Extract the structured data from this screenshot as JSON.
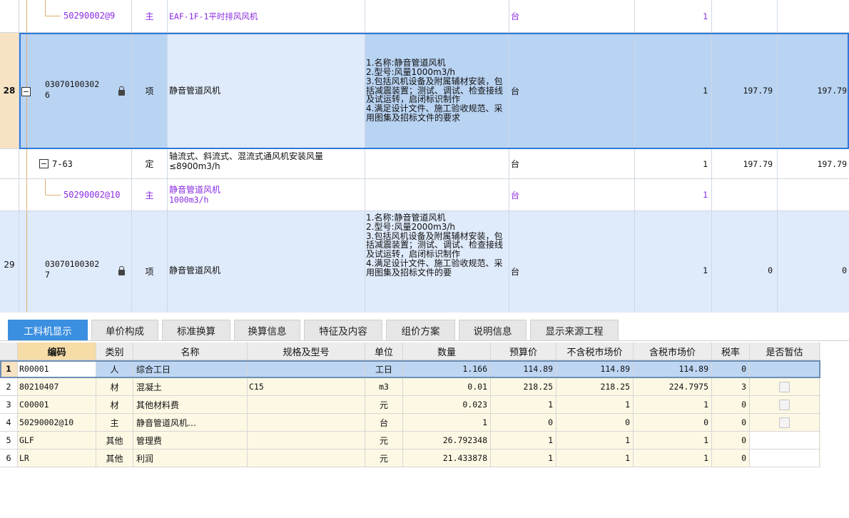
{
  "upper_rows": [
    {
      "row_num": "",
      "code": "50290002@9",
      "type": "主",
      "name": "EAF-1F-1平时排风风机",
      "features": "",
      "unit": "台",
      "qty": "1",
      "price1": "",
      "price2": ""
    },
    {
      "row_num": "28",
      "code_line1": "03070100302",
      "code_line2": "6",
      "type": "项",
      "name": "静音管道风机",
      "features": "1.名称:静音管道风机\n2.型号:风量1000m3/h\n3.包括风机设备及附属辅材安装，包括减震装置；测试、调试、检查接线及试运转，启闭标识制作\n4.满足设计文件、施工验收规范、采用图集及招标文件的要求",
      "unit": "台",
      "qty": "1",
      "price1": "197.79",
      "price2": "197.79"
    },
    {
      "row_num": "",
      "code": "7-63",
      "type": "定",
      "name": "轴流式、斜流式、混流式通风机安装风量≤8900m3/h",
      "features": "",
      "unit": "台",
      "qty": "1",
      "price1": "197.79",
      "price2": "197.79"
    },
    {
      "row_num": "",
      "code": "50290002@10",
      "type": "主",
      "name_line1": "静音管道风机",
      "name_line2": "1000m3/h",
      "features": "",
      "unit": "台",
      "qty": "1",
      "price1": "",
      "price2": ""
    },
    {
      "row_num": "29",
      "code_line1": "03070100302",
      "code_line2": "7",
      "type": "项",
      "name": "静音管道风机",
      "features": "1.名称:静音管道风机\n2.型号:风量2000m3/h\n3.包括风机设备及附属辅材安装，包括减震装置；测试、调试、检查接线及试运转，启闭标识制作\n4.满足设计文件、施工验收规范、采用图集及招标文件的要",
      "unit": "台",
      "qty": "1",
      "price1": "0",
      "price2": "0"
    }
  ],
  "tabs": [
    "工料机显示",
    "单价构成",
    "标准换算",
    "换算信息",
    "特征及内容",
    "组价方案",
    "说明信息",
    "显示来源工程"
  ],
  "lower_headers": [
    "",
    "编码",
    "类别",
    "名称",
    "规格及型号",
    "单位",
    "数量",
    "预算价",
    "不含税市场价",
    "含税市场价",
    "税率",
    "是否暂估"
  ],
  "lower_rows": [
    {
      "n": "1",
      "code": "R00001",
      "cat": "人",
      "name": "综合工日",
      "spec": "",
      "unit": "工日",
      "qty": "1.166",
      "budget": "114.89",
      "mkt_ex": "114.89",
      "mkt_in": "114.89",
      "tax": "0",
      "checkbox": false
    },
    {
      "n": "2",
      "code": "80210407",
      "cat": "材",
      "name": "混凝土",
      "spec": "C15",
      "unit": "m3",
      "qty": "0.01",
      "budget": "218.25",
      "mkt_ex": "218.25",
      "mkt_in": "224.7975",
      "tax": "3",
      "checkbox": true
    },
    {
      "n": "3",
      "code": "C00001",
      "cat": "材",
      "name": "其他材料费",
      "spec": "",
      "unit": "元",
      "qty": "0.023",
      "budget": "1",
      "mkt_ex": "1",
      "mkt_in": "1",
      "tax": "0",
      "checkbox": true
    },
    {
      "n": "4",
      "code": "50290002@10",
      "cat": "主",
      "name": "静音管道风机…",
      "spec": "",
      "unit": "台",
      "qty": "1",
      "budget": "0",
      "mkt_ex": "0",
      "mkt_in": "0",
      "tax": "0",
      "checkbox": true
    },
    {
      "n": "5",
      "code": "GLF",
      "cat": "其他",
      "name": "管理费",
      "spec": "",
      "unit": "元",
      "qty": "26.792348",
      "budget": "1",
      "mkt_ex": "1",
      "mkt_in": "1",
      "tax": "0",
      "checkbox": false
    },
    {
      "n": "6",
      "code": "LR",
      "cat": "其他",
      "name": "利润",
      "spec": "",
      "unit": "元",
      "qty": "21.433878",
      "budget": "1",
      "mkt_ex": "1",
      "mkt_in": "1",
      "tax": "0",
      "checkbox": false
    }
  ],
  "colors": {
    "selected_row": "#b9d3f2",
    "selected_border": "#2f7ad6",
    "alt_row": "#dfeafa",
    "main_material_text": "#8a2be2",
    "active_tab": "#3b8fe0",
    "header_code_bg": "#f6dca6"
  },
  "icons": {
    "lock": "lock-icon",
    "collapse": "collapse-minus-icon",
    "checkbox": "checkbox-icon"
  }
}
